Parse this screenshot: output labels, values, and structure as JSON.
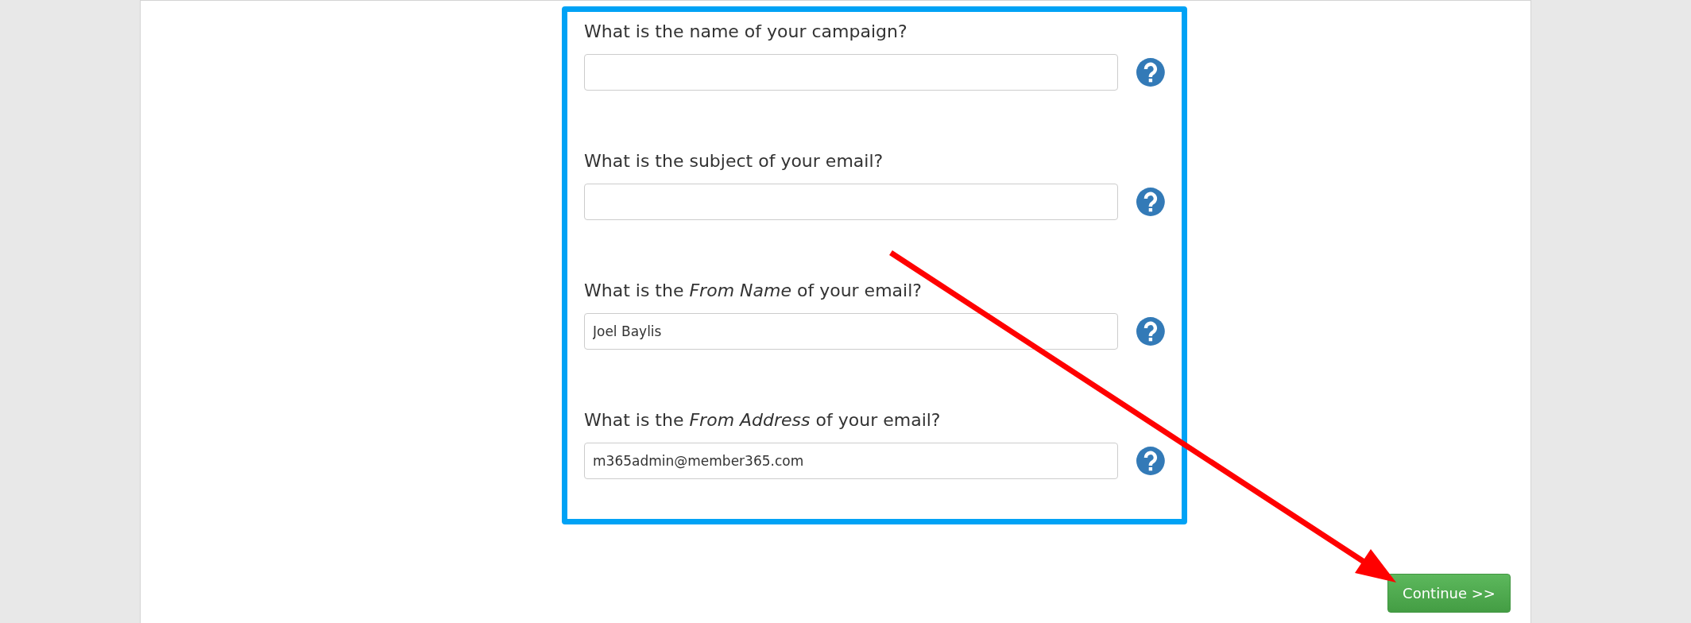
{
  "form": {
    "fields": [
      {
        "label": "What is the name of your campaign?"
      },
      {
        "label": "What is the subject of your email?"
      },
      {
        "label": "What is the *From Name* of your email?",
        "value": "Joel Baylis"
      },
      {
        "label": "What is the *From Address* of your email?",
        "value": "m365admin@member365.com"
      }
    ]
  },
  "continue_button": {
    "label": "Continue >>"
  }
}
